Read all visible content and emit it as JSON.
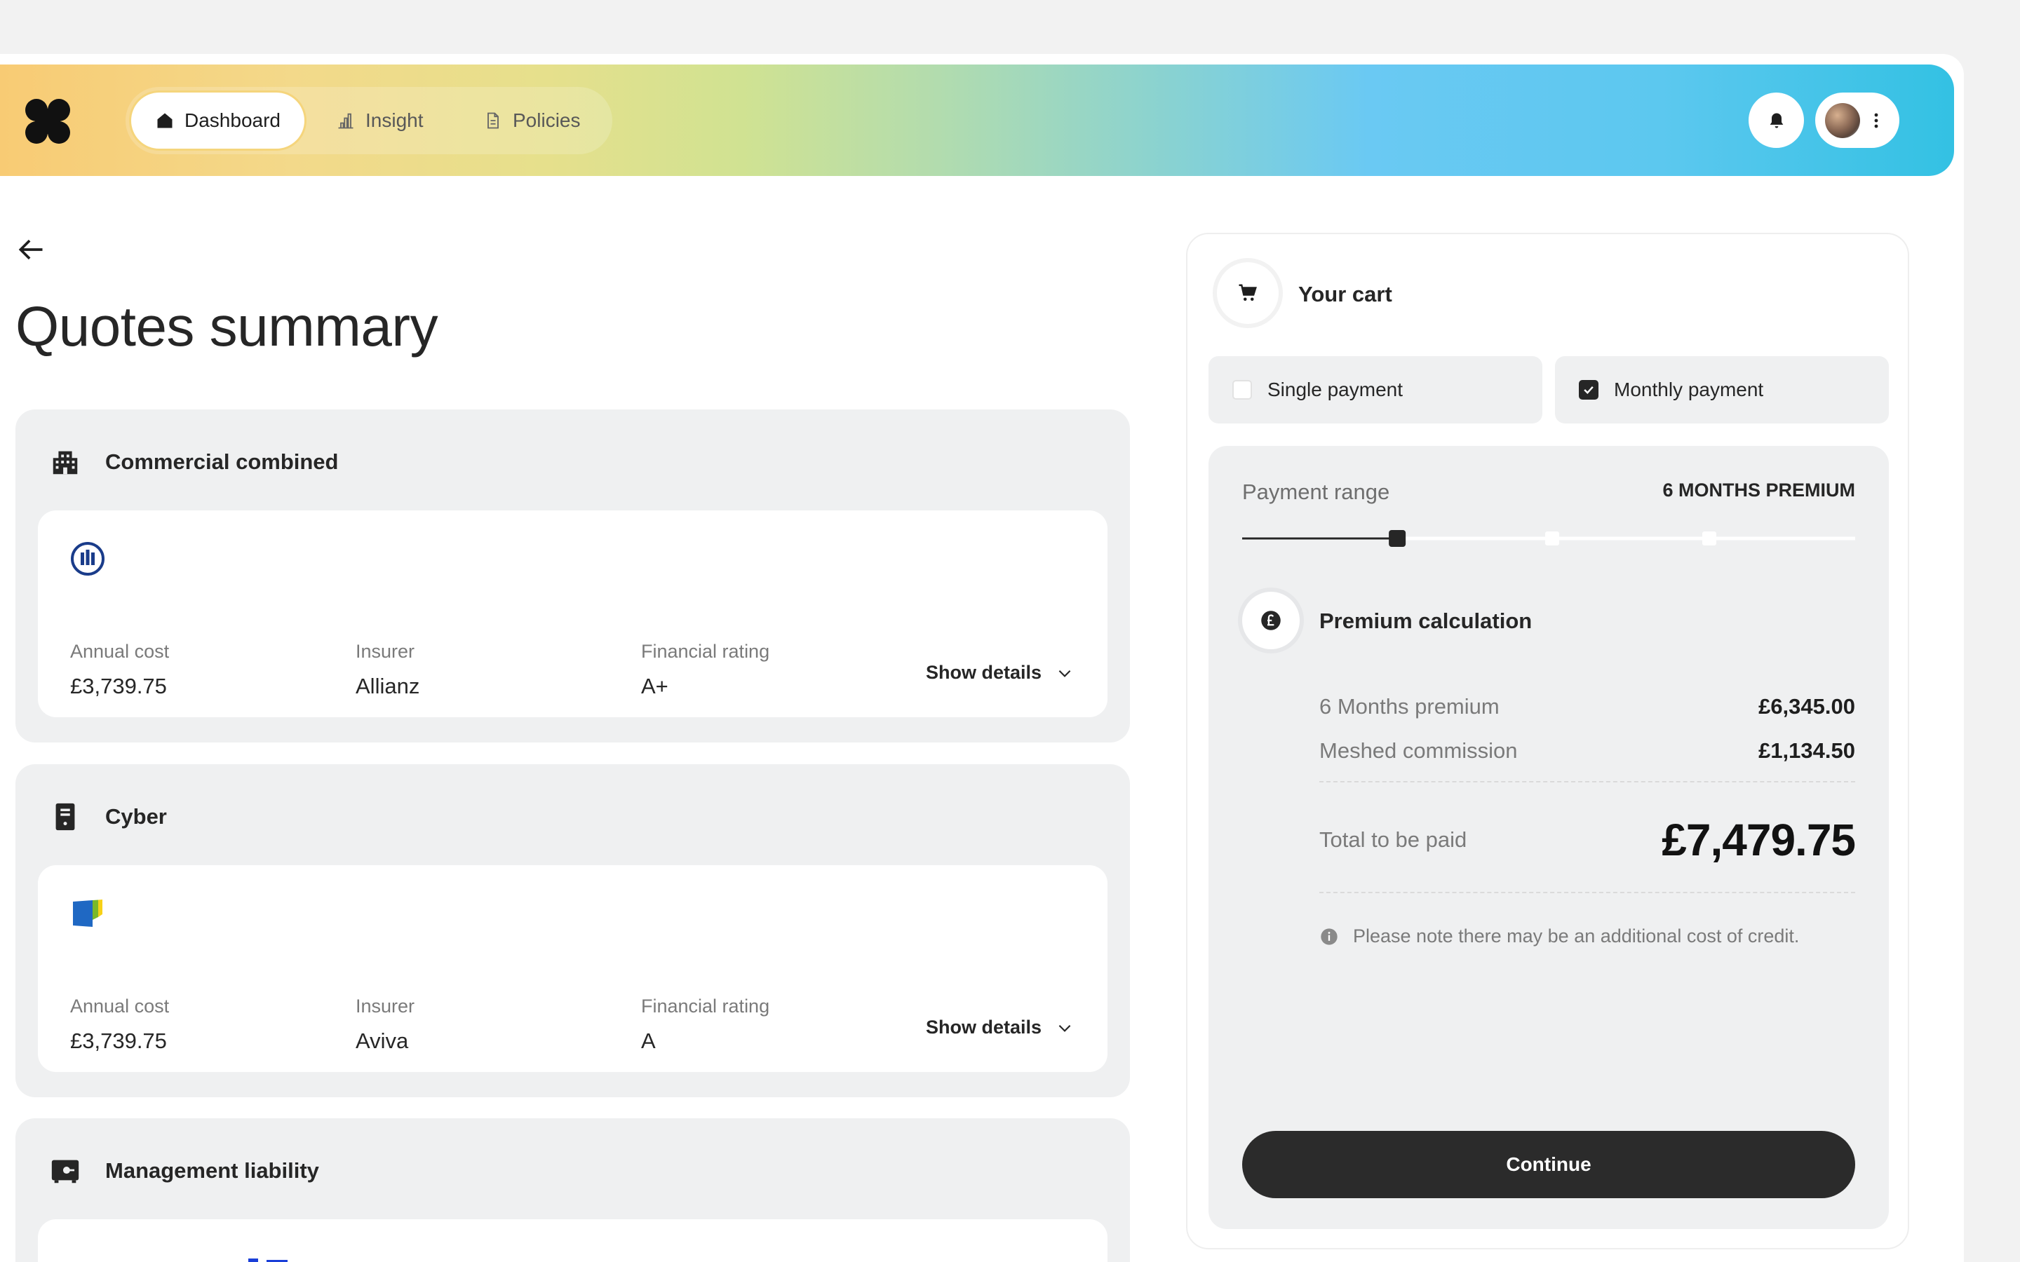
{
  "nav": {
    "tabs": [
      {
        "label": "Dashboard",
        "icon": "home-icon",
        "active": true
      },
      {
        "label": "Insight",
        "icon": "bar-chart-icon",
        "active": false
      },
      {
        "label": "Policies",
        "icon": "document-icon",
        "active": false
      }
    ]
  },
  "page": {
    "title": "Quotes summary"
  },
  "sections": [
    {
      "title": "Commercial combined",
      "icon": "building-icon",
      "annual_cost_label": "Annual cost",
      "annual_cost": "£3,739.75",
      "insurer_label": "Insurer",
      "insurer": "Allianz",
      "rating_label": "Financial rating",
      "rating": "A+",
      "details_label": "Show details"
    },
    {
      "title": "Cyber",
      "icon": "server-icon",
      "annual_cost_label": "Annual cost",
      "annual_cost": "£3,739.75",
      "insurer_label": "Insurer",
      "insurer": "Aviva",
      "rating_label": "Financial rating",
      "rating": "A",
      "details_label": "Show details"
    },
    {
      "title": "Management liability",
      "icon": "safe-icon"
    }
  ],
  "cart": {
    "title": "Your cart",
    "options": [
      {
        "label": "Single payment",
        "checked": false
      },
      {
        "label": "Monthly payment",
        "checked": true
      }
    ],
    "range_label": "Payment range",
    "range_value": "6 MONTHS PREMIUM",
    "range_position": 0.25,
    "calc_title": "Premium calculation",
    "items": [
      {
        "label": "6 Months premium",
        "value": "£6,345.00"
      },
      {
        "label": "Meshed commission",
        "value": "£1,134.50"
      }
    ],
    "total_label": "Total to be paid",
    "total_value": "£7,479.75",
    "note": "Please note there may be an additional cost of credit.",
    "continue_label": "Continue"
  },
  "colors": {
    "accent_dark": "#2b2b2b",
    "allianz_blue": "#1a3c8a",
    "aviva_blue": "#1f68c3",
    "aviva_green": "#7ab829"
  }
}
